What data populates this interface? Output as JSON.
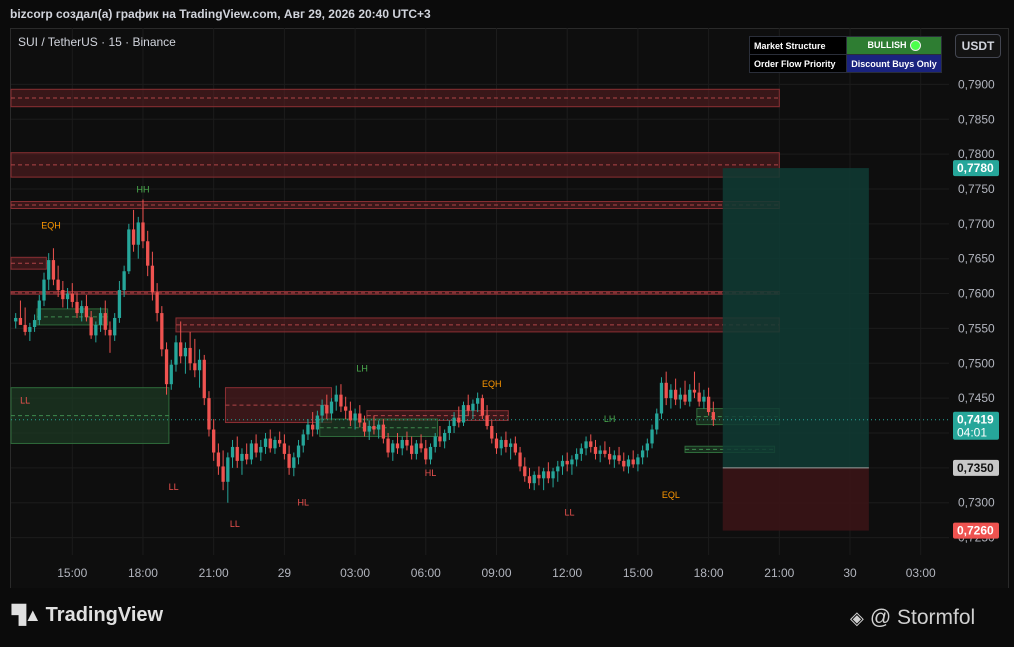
{
  "header": {
    "title": "bizcorp создал(а) график на TradingView.com, Авг 29, 2026 20:40 UTC+3",
    "symbol": "SUI / TetherUS · 15 · Binance",
    "currency": "USDT"
  },
  "indicator_table": {
    "row1_label": "Market Structure",
    "row1_value": "BULLISH",
    "row2_label": "Order Flow Priority",
    "row2_value": "Discount Buys Only"
  },
  "footer": {
    "brand": "TradingView",
    "credit": "@ Stormfol"
  },
  "colors": {
    "up": "#26a69a",
    "down": "#ef5350",
    "supply_zone": "#5d1f22",
    "demand_zone": "#1d3b24",
    "target_zone": "#0f3b34",
    "stop_zone": "#3a1416"
  },
  "chart_data": {
    "type": "candlestick",
    "ylim": [
      0.7225,
      0.7935
    ],
    "yticks": [
      "0,7900",
      "0,7850",
      "0,7800",
      "0,7750",
      "0,7700",
      "0,7650",
      "0,7600",
      "0,7550",
      "0,7500",
      "0,7450",
      "0,7400",
      "0,7350",
      "0,7300",
      "0,7250"
    ],
    "ytick_values": [
      0.79,
      0.785,
      0.78,
      0.775,
      0.77,
      0.765,
      0.76,
      0.755,
      0.75,
      0.745,
      0.74,
      0.735,
      0.73,
      0.725
    ],
    "xticks": [
      "15:00",
      "18:00",
      "21:00",
      "29",
      "03:00",
      "06:00",
      "09:00",
      "12:00",
      "15:00",
      "18:00",
      "21:00",
      "30",
      "03:00"
    ],
    "xtick_values": [
      15,
      18,
      21,
      24,
      27,
      30,
      33,
      36,
      39,
      42,
      45,
      48,
      51
    ],
    "xlim": [
      12.4,
      52.2
    ],
    "price_labels": [
      {
        "value": 0.778,
        "text": "0,7780",
        "color": "#26a69a"
      },
      {
        "value": 0.7419,
        "text": "0,7419",
        "sub": "04:01",
        "color": "#26a69a"
      },
      {
        "value": 0.735,
        "text": "0,7350",
        "color": "#c8c8c8"
      },
      {
        "value": 0.726,
        "text": "0,7260",
        "color": "#ef5350"
      }
    ],
    "position": {
      "entry": 0.735,
      "target": 0.778,
      "stop": 0.726,
      "x_start": 42.6,
      "x_end": 48.8
    },
    "supply_zones": [
      {
        "x0": 12.4,
        "x1": 45.0,
        "y0": 0.7868,
        "y1": 0.7893
      },
      {
        "x0": 12.4,
        "x1": 45.0,
        "y0": 0.7767,
        "y1": 0.7802
      },
      {
        "x0": 12.4,
        "x1": 45.0,
        "y0": 0.7722,
        "y1": 0.7732
      },
      {
        "x0": 12.4,
        "x1": 45.0,
        "y0": 0.7599,
        "y1": 0.7603
      },
      {
        "x0": 19.4,
        "x1": 45.0,
        "y0": 0.7545,
        "y1": 0.7565
      },
      {
        "x0": 12.4,
        "x1": 13.9,
        "y0": 0.7635,
        "y1": 0.7652
      },
      {
        "x0": 21.5,
        "x1": 26.0,
        "y0": 0.7415,
        "y1": 0.7465
      },
      {
        "x0": 27.5,
        "x1": 33.5,
        "y0": 0.7418,
        "y1": 0.7432
      }
    ],
    "demand_zones": [
      {
        "x0": 12.4,
        "x1": 19.1,
        "y0": 0.7385,
        "y1": 0.7465
      },
      {
        "x0": 13.5,
        "x1": 16.5,
        "y0": 0.7555,
        "y1": 0.7578
      },
      {
        "x0": 25.5,
        "x1": 30.5,
        "y0": 0.7395,
        "y1": 0.742
      },
      {
        "x0": 41.5,
        "x1": 45.0,
        "y0": 0.7412,
        "y1": 0.7435
      },
      {
        "x0": 41.0,
        "x1": 44.8,
        "y0": 0.7372,
        "y1": 0.7381
      }
    ],
    "structure_labels": [
      {
        "text": "HH",
        "x": 18.0,
        "y": 0.7745,
        "color": "#4caf50"
      },
      {
        "text": "EQH",
        "x": 14.1,
        "y": 0.7693,
        "color": "#ff9800"
      },
      {
        "text": "LL",
        "x": 13.0,
        "y": 0.7442,
        "color": "#ef5350"
      },
      {
        "text": "LL",
        "x": 19.3,
        "y": 0.7318,
        "color": "#ef5350"
      },
      {
        "text": "LL",
        "x": 21.9,
        "y": 0.7265,
        "color": "#ef5350"
      },
      {
        "text": "HL",
        "x": 24.8,
        "y": 0.7296,
        "color": "#ef5350"
      },
      {
        "text": "LH",
        "x": 27.3,
        "y": 0.7488,
        "color": "#4caf50"
      },
      {
        "text": "HL",
        "x": 30.2,
        "y": 0.7338,
        "color": "#ef5350"
      },
      {
        "text": "EQH",
        "x": 32.8,
        "y": 0.7466,
        "color": "#ff9800"
      },
      {
        "text": "LL",
        "x": 36.1,
        "y": 0.7282,
        "color": "#ef5350"
      },
      {
        "text": "LH",
        "x": 37.8,
        "y": 0.7416,
        "color": "#4caf50"
      },
      {
        "text": "EQL",
        "x": 40.4,
        "y": 0.7307,
        "color": "#ff9800"
      }
    ],
    "candles": [
      [
        12.6,
        0.756,
        0.7572,
        0.755,
        0.7565
      ],
      [
        12.8,
        0.7565,
        0.759,
        0.7558,
        0.7555
      ],
      [
        13.0,
        0.7555,
        0.758,
        0.754,
        0.7545
      ],
      [
        13.2,
        0.7545,
        0.7558,
        0.7532,
        0.7552
      ],
      [
        13.4,
        0.7552,
        0.757,
        0.7545,
        0.7562
      ],
      [
        13.6,
        0.7562,
        0.7598,
        0.7555,
        0.759
      ],
      [
        13.8,
        0.759,
        0.763,
        0.7582,
        0.762
      ],
      [
        14.0,
        0.762,
        0.7658,
        0.7605,
        0.7648
      ],
      [
        14.2,
        0.7648,
        0.7665,
        0.7612,
        0.762
      ],
      [
        14.4,
        0.762,
        0.764,
        0.7595,
        0.7605
      ],
      [
        14.6,
        0.7605,
        0.7618,
        0.758,
        0.7592
      ],
      [
        14.8,
        0.7592,
        0.7608,
        0.7578,
        0.76
      ],
      [
        15.0,
        0.76,
        0.7615,
        0.758,
        0.7588
      ],
      [
        15.2,
        0.7588,
        0.76,
        0.7565,
        0.7572
      ],
      [
        15.4,
        0.7572,
        0.759,
        0.756,
        0.7582
      ],
      [
        15.6,
        0.7582,
        0.7598,
        0.756,
        0.7566
      ],
      [
        15.8,
        0.7566,
        0.7575,
        0.7535,
        0.754
      ],
      [
        16.0,
        0.754,
        0.756,
        0.753,
        0.7555
      ],
      [
        16.2,
        0.7555,
        0.758,
        0.7545,
        0.7572
      ],
      [
        16.4,
        0.7572,
        0.759,
        0.754,
        0.7548
      ],
      [
        16.6,
        0.7548,
        0.756,
        0.7515,
        0.754
      ],
      [
        16.8,
        0.754,
        0.7572,
        0.7532,
        0.7565
      ],
      [
        17.0,
        0.7565,
        0.7618,
        0.7558,
        0.7605
      ],
      [
        17.2,
        0.7605,
        0.764,
        0.7595,
        0.7632
      ],
      [
        17.4,
        0.7632,
        0.77,
        0.7628,
        0.7692
      ],
      [
        17.6,
        0.7692,
        0.772,
        0.766,
        0.767
      ],
      [
        17.8,
        0.767,
        0.771,
        0.765,
        0.7702
      ],
      [
        18.0,
        0.7702,
        0.7735,
        0.7665,
        0.7675
      ],
      [
        18.2,
        0.7675,
        0.769,
        0.7625,
        0.764
      ],
      [
        18.4,
        0.764,
        0.766,
        0.759,
        0.7602
      ],
      [
        18.6,
        0.7602,
        0.7615,
        0.756,
        0.7572
      ],
      [
        18.8,
        0.7572,
        0.7582,
        0.751,
        0.752
      ],
      [
        19.0,
        0.752,
        0.753,
        0.7455,
        0.747
      ],
      [
        19.2,
        0.747,
        0.7505,
        0.7462,
        0.7498
      ],
      [
        19.4,
        0.7498,
        0.754,
        0.7488,
        0.753
      ],
      [
        19.6,
        0.753,
        0.756,
        0.75,
        0.751
      ],
      [
        19.8,
        0.751,
        0.753,
        0.7485,
        0.7522
      ],
      [
        20.0,
        0.7522,
        0.7545,
        0.749,
        0.75
      ],
      [
        20.2,
        0.75,
        0.7535,
        0.748,
        0.749
      ],
      [
        20.4,
        0.749,
        0.752,
        0.7465,
        0.7505
      ],
      [
        20.6,
        0.7505,
        0.7512,
        0.744,
        0.745
      ],
      [
        20.8,
        0.745,
        0.746,
        0.7395,
        0.7405
      ],
      [
        21.0,
        0.7405,
        0.742,
        0.736,
        0.7372
      ],
      [
        21.2,
        0.7372,
        0.7385,
        0.734,
        0.7352
      ],
      [
        21.4,
        0.7352,
        0.7375,
        0.7318,
        0.733
      ],
      [
        21.6,
        0.733,
        0.7372,
        0.73,
        0.7365
      ],
      [
        21.8,
        0.7365,
        0.739,
        0.735,
        0.738
      ],
      [
        22.0,
        0.738,
        0.7395,
        0.735,
        0.736
      ],
      [
        22.2,
        0.736,
        0.7378,
        0.734,
        0.737
      ],
      [
        22.4,
        0.737,
        0.7385,
        0.7355,
        0.7362
      ],
      [
        22.6,
        0.7362,
        0.739,
        0.7355,
        0.7385
      ],
      [
        22.8,
        0.7385,
        0.7398,
        0.7365,
        0.7372
      ],
      [
        23.0,
        0.7372,
        0.739,
        0.736,
        0.738
      ],
      [
        23.2,
        0.738,
        0.74,
        0.737,
        0.7392
      ],
      [
        23.4,
        0.7392,
        0.7405,
        0.7372,
        0.7378
      ],
      [
        23.6,
        0.7378,
        0.7395,
        0.737,
        0.739
      ],
      [
        23.8,
        0.739,
        0.7402,
        0.738,
        0.7385
      ],
      [
        24.0,
        0.7385,
        0.7398,
        0.7362,
        0.737
      ],
      [
        24.2,
        0.737,
        0.7382,
        0.734,
        0.735
      ],
      [
        24.4,
        0.735,
        0.7372,
        0.7338,
        0.7365
      ],
      [
        24.6,
        0.7365,
        0.739,
        0.7355,
        0.7382
      ],
      [
        24.8,
        0.7382,
        0.7405,
        0.7372,
        0.7398
      ],
      [
        25.0,
        0.7398,
        0.742,
        0.739,
        0.7412
      ],
      [
        25.2,
        0.7412,
        0.743,
        0.7395,
        0.7405
      ],
      [
        25.4,
        0.7405,
        0.7432,
        0.7398,
        0.7425
      ],
      [
        25.6,
        0.7425,
        0.7448,
        0.7415,
        0.744
      ],
      [
        25.8,
        0.744,
        0.7455,
        0.742,
        0.7428
      ],
      [
        26.0,
        0.7428,
        0.745,
        0.742,
        0.7445
      ],
      [
        26.2,
        0.7445,
        0.7468,
        0.7432,
        0.7455
      ],
      [
        26.4,
        0.7455,
        0.747,
        0.743,
        0.7438
      ],
      [
        26.6,
        0.7438,
        0.7452,
        0.742,
        0.7432
      ],
      [
        26.8,
        0.7432,
        0.7445,
        0.741,
        0.7418
      ],
      [
        27.0,
        0.7418,
        0.7435,
        0.7405,
        0.7428
      ],
      [
        27.2,
        0.7428,
        0.744,
        0.7408,
        0.7415
      ],
      [
        27.4,
        0.7415,
        0.7425,
        0.7395,
        0.7402
      ],
      [
        27.6,
        0.7402,
        0.7418,
        0.739,
        0.741
      ],
      [
        27.8,
        0.741,
        0.7425,
        0.7398,
        0.7405
      ],
      [
        28.0,
        0.7405,
        0.7418,
        0.7392,
        0.7412
      ],
      [
        28.2,
        0.7412,
        0.742,
        0.7385,
        0.7392
      ],
      [
        28.4,
        0.7392,
        0.74,
        0.7365,
        0.7372
      ],
      [
        28.6,
        0.7372,
        0.739,
        0.736,
        0.7385
      ],
      [
        28.8,
        0.7385,
        0.74,
        0.737,
        0.7378
      ],
      [
        29.0,
        0.7378,
        0.7395,
        0.7368,
        0.739
      ],
      [
        29.2,
        0.739,
        0.7402,
        0.7375,
        0.7382
      ],
      [
        29.4,
        0.7382,
        0.7395,
        0.7362,
        0.737
      ],
      [
        29.6,
        0.737,
        0.739,
        0.7362,
        0.7385
      ],
      [
        29.8,
        0.7385,
        0.7398,
        0.7372,
        0.7378
      ],
      [
        30.0,
        0.7378,
        0.739,
        0.7355,
        0.7362
      ],
      [
        30.2,
        0.7362,
        0.7385,
        0.7355,
        0.738
      ],
      [
        30.4,
        0.738,
        0.74,
        0.7372,
        0.7395
      ],
      [
        30.6,
        0.7395,
        0.741,
        0.738,
        0.7388
      ],
      [
        30.8,
        0.7388,
        0.7405,
        0.7378,
        0.74
      ],
      [
        31.0,
        0.74,
        0.7418,
        0.739,
        0.741
      ],
      [
        31.2,
        0.741,
        0.743,
        0.74,
        0.7422
      ],
      [
        31.4,
        0.7422,
        0.7438,
        0.7408,
        0.7415
      ],
      [
        31.6,
        0.7415,
        0.7445,
        0.741,
        0.744
      ],
      [
        31.8,
        0.744,
        0.7455,
        0.7425,
        0.7432
      ],
      [
        32.0,
        0.7432,
        0.7448,
        0.742,
        0.7442
      ],
      [
        32.2,
        0.7442,
        0.7458,
        0.743,
        0.745
      ],
      [
        32.4,
        0.745,
        0.7455,
        0.742,
        0.7425
      ],
      [
        32.6,
        0.7425,
        0.744,
        0.7405,
        0.741
      ],
      [
        32.8,
        0.741,
        0.7418,
        0.7385,
        0.7392
      ],
      [
        33.0,
        0.7392,
        0.74,
        0.737,
        0.7378
      ],
      [
        33.2,
        0.7378,
        0.7395,
        0.7368,
        0.739
      ],
      [
        33.4,
        0.739,
        0.7402,
        0.7372,
        0.738
      ],
      [
        33.6,
        0.738,
        0.7392,
        0.7362,
        0.7385
      ],
      [
        33.8,
        0.7385,
        0.7395,
        0.7368,
        0.7372
      ],
      [
        34.0,
        0.7372,
        0.738,
        0.7345,
        0.7352
      ],
      [
        34.2,
        0.7352,
        0.7365,
        0.733,
        0.7338
      ],
      [
        34.4,
        0.7338,
        0.735,
        0.732,
        0.7328
      ],
      [
        34.6,
        0.7328,
        0.7345,
        0.7318,
        0.734
      ],
      [
        34.8,
        0.734,
        0.7352,
        0.7325,
        0.7335
      ],
      [
        35.0,
        0.7335,
        0.735,
        0.7318,
        0.7345
      ],
      [
        35.2,
        0.7345,
        0.7358,
        0.7328,
        0.7335
      ],
      [
        35.4,
        0.7335,
        0.735,
        0.7322,
        0.7345
      ],
      [
        35.6,
        0.7345,
        0.736,
        0.733,
        0.7352
      ],
      [
        35.8,
        0.7352,
        0.7368,
        0.734,
        0.736
      ],
      [
        36.0,
        0.736,
        0.7372,
        0.7345,
        0.7355
      ],
      [
        36.2,
        0.7355,
        0.7368,
        0.734,
        0.7362
      ],
      [
        36.4,
        0.7362,
        0.7378,
        0.7352,
        0.737
      ],
      [
        36.6,
        0.737,
        0.7385,
        0.736,
        0.7378
      ],
      [
        36.8,
        0.7378,
        0.7395,
        0.7368,
        0.7388
      ],
      [
        37.0,
        0.7388,
        0.7398,
        0.7372,
        0.738
      ],
      [
        37.2,
        0.738,
        0.739,
        0.7362,
        0.737
      ],
      [
        37.4,
        0.737,
        0.7382,
        0.7358,
        0.7375
      ],
      [
        37.6,
        0.7375,
        0.7388,
        0.7365,
        0.737
      ],
      [
        37.8,
        0.737,
        0.738,
        0.7355,
        0.7362
      ],
      [
        38.0,
        0.7362,
        0.7375,
        0.735,
        0.7368
      ],
      [
        38.2,
        0.7368,
        0.738,
        0.7355,
        0.736
      ],
      [
        38.4,
        0.736,
        0.7372,
        0.7345,
        0.7352
      ],
      [
        38.6,
        0.7352,
        0.7368,
        0.7342,
        0.7362
      ],
      [
        38.8,
        0.7362,
        0.7375,
        0.735,
        0.7355
      ],
      [
        39.0,
        0.7355,
        0.737,
        0.7345,
        0.7365
      ],
      [
        39.2,
        0.7365,
        0.7382,
        0.7355,
        0.7375
      ],
      [
        39.4,
        0.7375,
        0.7392,
        0.7365,
        0.7385
      ],
      [
        39.6,
        0.7385,
        0.7412,
        0.7378,
        0.7405
      ],
      [
        39.8,
        0.7405,
        0.7435,
        0.7398,
        0.7428
      ],
      [
        40.0,
        0.7428,
        0.748,
        0.742,
        0.7472
      ],
      [
        40.2,
        0.7472,
        0.7488,
        0.744,
        0.745
      ],
      [
        40.4,
        0.745,
        0.747,
        0.7435,
        0.7462
      ],
      [
        40.6,
        0.7462,
        0.7478,
        0.744,
        0.7448
      ],
      [
        40.8,
        0.7448,
        0.7465,
        0.7435,
        0.7455
      ],
      [
        41.0,
        0.7455,
        0.7475,
        0.744,
        0.7445
      ],
      [
        41.2,
        0.7445,
        0.747,
        0.7438,
        0.7462
      ],
      [
        41.4,
        0.7462,
        0.7488,
        0.745,
        0.7458
      ],
      [
        41.6,
        0.7458,
        0.7472,
        0.7438,
        0.7445
      ],
      [
        41.8,
        0.7445,
        0.7462,
        0.7435,
        0.7452
      ],
      [
        42.0,
        0.7452,
        0.7465,
        0.7425,
        0.743
      ],
      [
        42.2,
        0.743,
        0.7445,
        0.741,
        0.7419
      ]
    ]
  }
}
